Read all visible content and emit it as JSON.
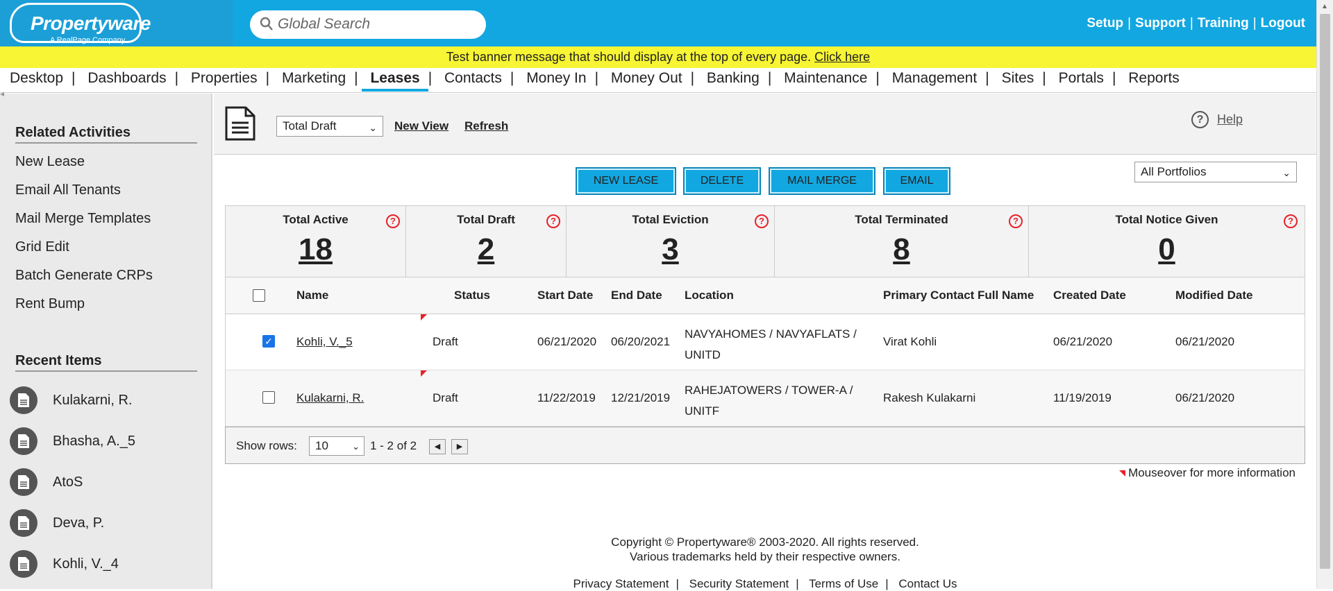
{
  "brand": {
    "name": "Propertyware",
    "tagline": "A RealPage Company"
  },
  "search": {
    "placeholder": "Global Search"
  },
  "toplinks": [
    "Setup",
    "Support",
    "Training",
    "Logout"
  ],
  "banner": {
    "message": "Test banner message that should display at the top of every page.",
    "link": "Click here"
  },
  "nav": [
    "Desktop",
    "Dashboards",
    "Properties",
    "Marketing",
    "Leases",
    "Contacts",
    "Money In",
    "Money Out",
    "Banking",
    "Maintenance",
    "Management",
    "Sites",
    "Portals",
    "Reports"
  ],
  "nav_active": "Leases",
  "sidebar": {
    "related_title": "Related Activities",
    "related": [
      "New Lease",
      "Email All Tenants",
      "Mail Merge Templates",
      "Grid Edit",
      "Batch Generate CRPs",
      "Rent Bump"
    ],
    "recent_title": "Recent Items",
    "recent": [
      "Kulakarni, R.",
      "Bhasha, A._5",
      "AtoS",
      "Deva, P.",
      "Kohli, V._4"
    ]
  },
  "view": {
    "selected": "Total Draft",
    "new_view": "New View",
    "refresh": "Refresh",
    "help": "Help"
  },
  "buttons": {
    "new_lease": "NEW LEASE",
    "delete": "DELETE",
    "mail_merge": "MAIL MERGE",
    "email": "EMAIL"
  },
  "portfolio": "All Portfolios",
  "totals": [
    {
      "label": "Total Active",
      "value": "18"
    },
    {
      "label": "Total Draft",
      "value": "2"
    },
    {
      "label": "Total Eviction",
      "value": "3"
    },
    {
      "label": "Total Terminated",
      "value": "8"
    },
    {
      "label": "Total Notice Given",
      "value": "0"
    }
  ],
  "columns": [
    "Name",
    "Status",
    "Start Date",
    "End Date",
    "Location",
    "Primary Contact Full Name",
    "Created Date",
    "Modified Date"
  ],
  "rows": [
    {
      "checked": true,
      "name": "Kohli, V._5",
      "status": "Draft",
      "start": "06/21/2020",
      "end": "06/20/2021",
      "loc1": "NAVYAHOMES / NAVYAFLATS /",
      "loc2": "UNITD",
      "contact": "Virat Kohli",
      "created": "06/21/2020",
      "modified": "06/21/2020"
    },
    {
      "checked": false,
      "name": "Kulakarni, R.",
      "status": "Draft",
      "start": "11/22/2019",
      "end": "12/21/2019",
      "loc1": "RAHEJATOWERS / TOWER-A /",
      "loc2": "UNITF",
      "contact": "Rakesh Kulakarni",
      "created": "11/19/2019",
      "modified": "06/21/2020"
    }
  ],
  "pager": {
    "show_rows_label": "Show rows:",
    "rows_value": "10",
    "range": "1 - 2 of 2"
  },
  "mouseover_note": "Mouseover for more information",
  "footer": {
    "copyright1": "Copyright © Propertyware® 2003-2020. All rights reserved.",
    "copyright2": "Various trademarks held by their respective owners.",
    "links": [
      "Privacy Statement",
      "Security Statement",
      "Terms of Use",
      "Contact Us"
    ]
  },
  "colors": {
    "brand_blue": "#12a7e0",
    "banner_yellow": "#f7f534",
    "alert_red": "#e8202a"
  }
}
